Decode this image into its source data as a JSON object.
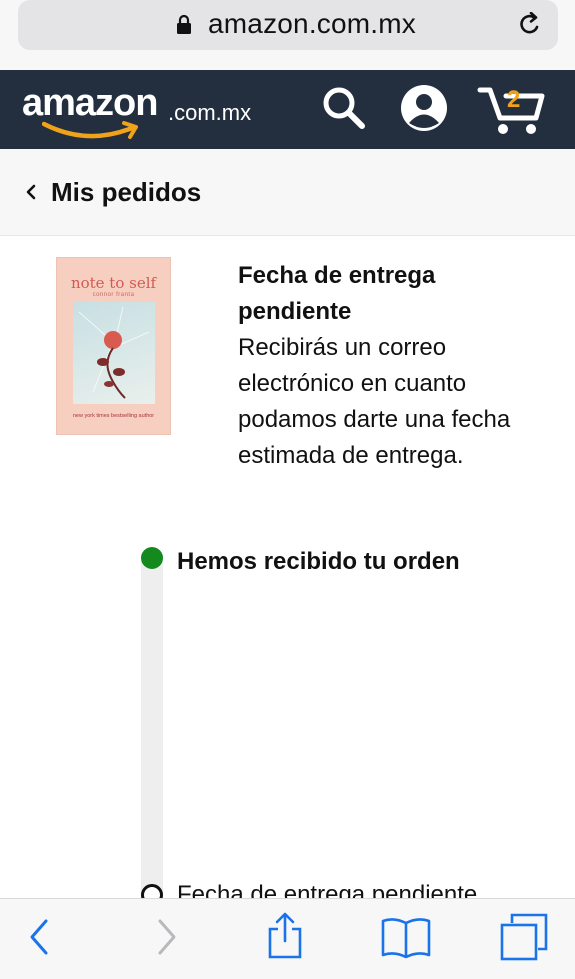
{
  "browser": {
    "url": "amazon.com.mx"
  },
  "header": {
    "logo_word": "amazon",
    "logo_domain": ".com.mx",
    "cart_count": "2",
    "colors": {
      "background": "#232f3e",
      "accent": "#f0a21a"
    }
  },
  "breadcrumb": {
    "label": "Mis pedidos"
  },
  "order": {
    "book": {
      "title": "note to self",
      "author": "connor franta",
      "tagline": "new york times bestselling author"
    },
    "status_title": "Fecha de entrega pendiente",
    "status_description": "Recibirás un correo electrónico en cuanto podamos darte una fecha estimada de entrega."
  },
  "tracking": {
    "steps": [
      {
        "label": "Hemos recibido tu orden",
        "state": "done",
        "color": "#148a1e"
      },
      {
        "label": "Fecha de entrega pendiente",
        "state": "pending"
      }
    ]
  },
  "toolbar": {
    "icons": [
      "back-icon",
      "forward-icon",
      "share-icon",
      "bookmarks-icon",
      "tabs-icon"
    ]
  }
}
